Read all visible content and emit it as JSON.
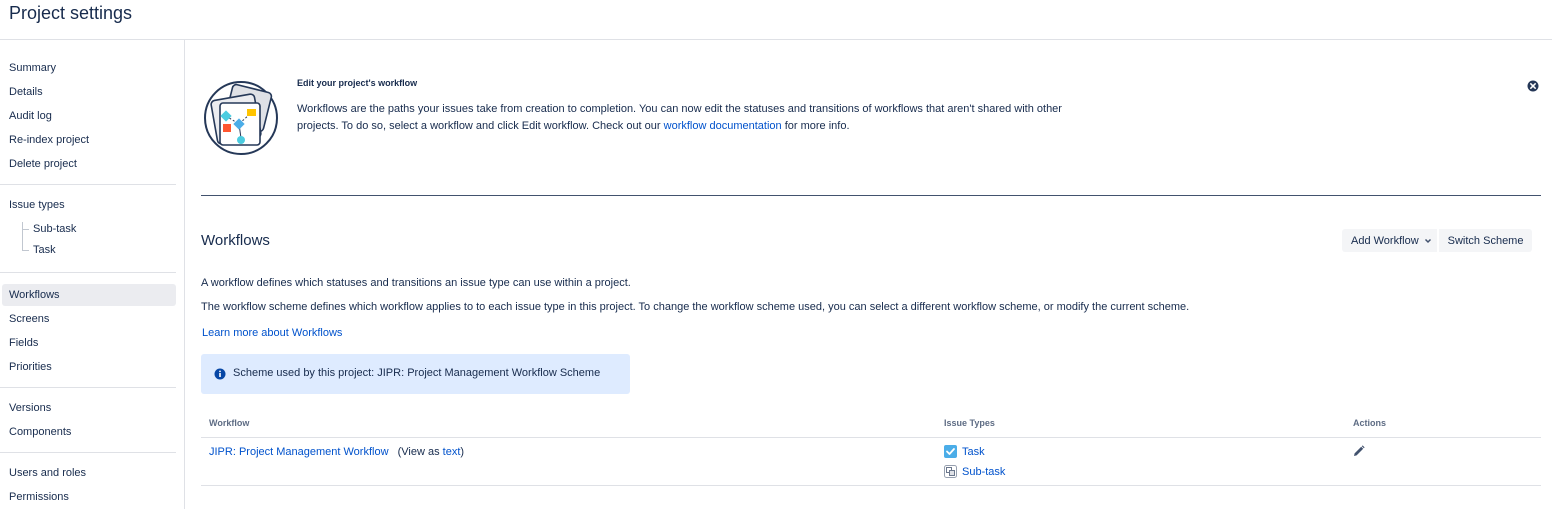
{
  "page": {
    "title": "Project settings"
  },
  "sidebar": {
    "group1": [
      "Summary",
      "Details",
      "Audit log",
      "Re-index project",
      "Delete project"
    ],
    "issue_types": {
      "label": "Issue types",
      "children": [
        "Sub-task",
        "Task"
      ]
    },
    "group3": [
      "Workflows",
      "Screens",
      "Fields",
      "Priorities"
    ],
    "group4": [
      "Versions",
      "Components"
    ],
    "group5": [
      "Users and roles",
      "Permissions"
    ],
    "selected": "Workflows"
  },
  "banner": {
    "title": "Edit your project's workflow",
    "text_before": "Workflows are the paths your issues take from creation to completion. You can now edit the statuses and transitions of workflows that aren't shared with other projects. To do so, select a workflow and click Edit workflow. Check out our ",
    "link": "workflow documentation",
    "text_after": " for more info."
  },
  "workflows": {
    "title": "Workflows",
    "add_button": "Add Workflow",
    "switch_button": "Switch Scheme",
    "desc1": "A workflow defines which statuses and transitions an issue type can use within a project.",
    "desc2": "The workflow scheme defines which workflow applies to to each issue type in this project. To change the workflow scheme used, you can select a different workflow scheme, or modify the current scheme.",
    "learn_more": "Learn more about Workflows",
    "scheme_label": "Scheme used by this project:",
    "scheme_name": "JIPR: Project Management Workflow Scheme"
  },
  "table": {
    "headers": {
      "workflow": "Workflow",
      "issue_types": "Issue Types",
      "actions": "Actions"
    },
    "rows": [
      {
        "workflow": "JIPR: Project Management Workflow",
        "view_as_prefix": "(View as ",
        "view_as_link": "text",
        "view_as_suffix": ")",
        "issue_types": [
          {
            "name": "Task",
            "icon": "task-icon"
          },
          {
            "name": "Sub-task",
            "icon": "subtask-icon"
          }
        ]
      }
    ]
  },
  "colors": {
    "link": "#0052cc",
    "info_bg": "#deebff",
    "selected_bg": "#ebecf0",
    "task_blue": "#4bade8"
  }
}
